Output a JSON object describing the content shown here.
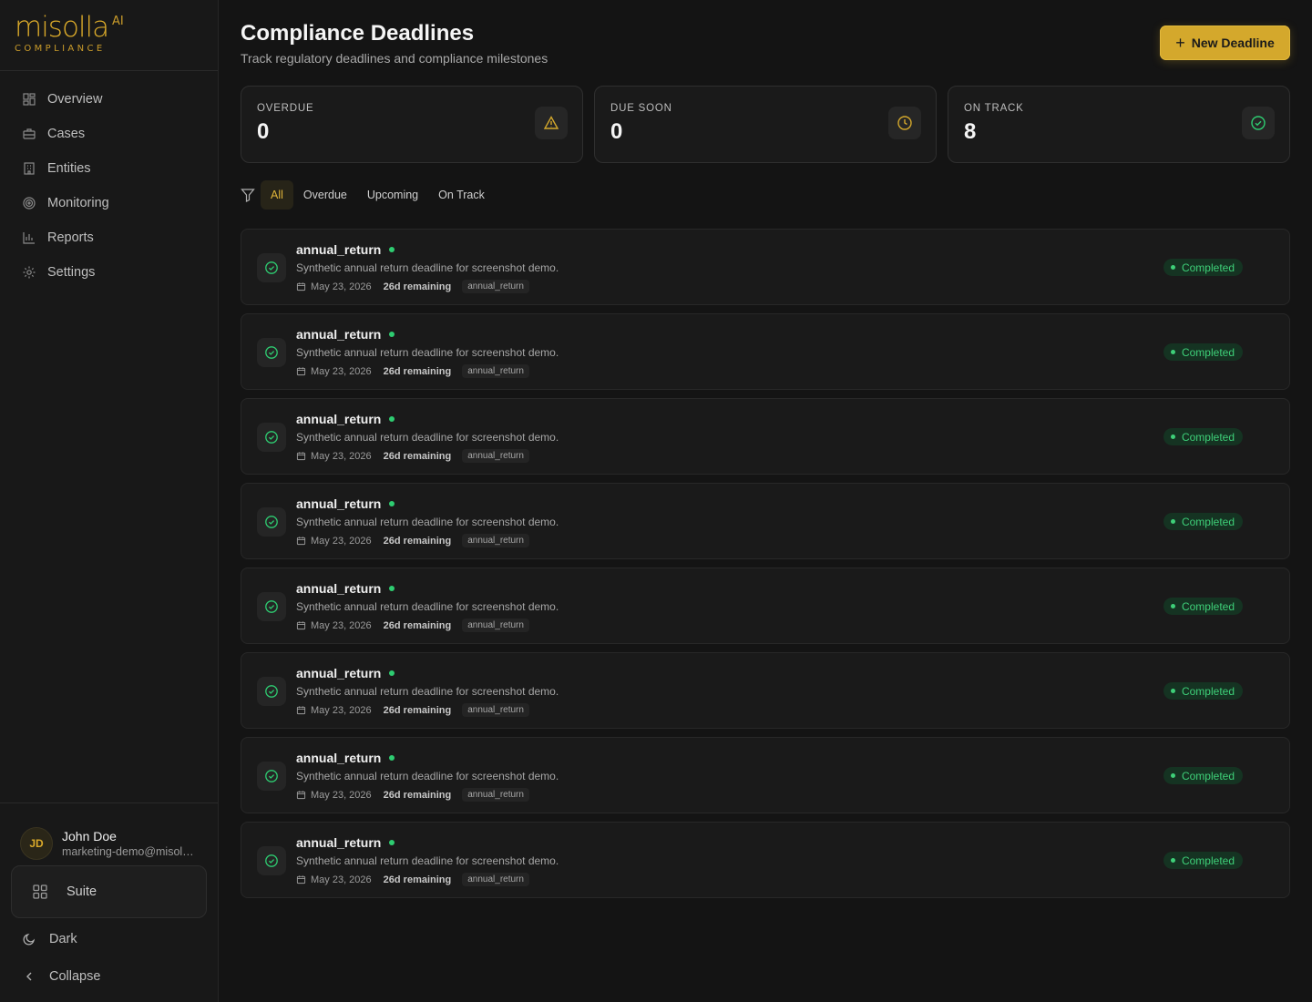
{
  "brand": {
    "name": "misolla",
    "ai": "AI",
    "sub": "COMPLIANCE",
    "accent": "#d4a82c"
  },
  "sidebar": {
    "items": [
      {
        "label": "Overview",
        "icon": "grid-icon"
      },
      {
        "label": "Cases",
        "icon": "briefcase-icon"
      },
      {
        "label": "Entities",
        "icon": "building-icon"
      },
      {
        "label": "Monitoring",
        "icon": "radar-icon"
      },
      {
        "label": "Reports",
        "icon": "bar-chart-icon"
      },
      {
        "label": "Settings",
        "icon": "gear-icon"
      }
    ],
    "user": {
      "initials": "JD",
      "name": "John Doe",
      "email": "marketing-demo@misolla.ai"
    },
    "suite_label": "Suite",
    "theme_label": "Dark",
    "collapse_label": "Collapse"
  },
  "header": {
    "title": "Compliance Deadlines",
    "subtitle": "Track regulatory deadlines and compliance milestones",
    "new_button": "New Deadline"
  },
  "stats": [
    {
      "label": "OVERDUE",
      "value": "0",
      "icon": "warning-icon",
      "color": "#d4a82c"
    },
    {
      "label": "DUE SOON",
      "value": "0",
      "icon": "clock-icon",
      "color": "#d4a82c"
    },
    {
      "label": "ON TRACK",
      "value": "8",
      "icon": "check-circle-icon",
      "color": "#2ecc71"
    }
  ],
  "filters": [
    "All",
    "Overdue",
    "Upcoming",
    "On Track"
  ],
  "deadlines": [
    {
      "title": "annual_return",
      "desc": "Synthetic annual return deadline for screenshot demo.",
      "date": "May 23, 2026",
      "remaining": "26d remaining",
      "tag": "annual_return",
      "status": "Completed"
    },
    {
      "title": "annual_return",
      "desc": "Synthetic annual return deadline for screenshot demo.",
      "date": "May 23, 2026",
      "remaining": "26d remaining",
      "tag": "annual_return",
      "status": "Completed"
    },
    {
      "title": "annual_return",
      "desc": "Synthetic annual return deadline for screenshot demo.",
      "date": "May 23, 2026",
      "remaining": "26d remaining",
      "tag": "annual_return",
      "status": "Completed"
    },
    {
      "title": "annual_return",
      "desc": "Synthetic annual return deadline for screenshot demo.",
      "date": "May 23, 2026",
      "remaining": "26d remaining",
      "tag": "annual_return",
      "status": "Completed"
    },
    {
      "title": "annual_return",
      "desc": "Synthetic annual return deadline for screenshot demo.",
      "date": "May 23, 2026",
      "remaining": "26d remaining",
      "tag": "annual_return",
      "status": "Completed"
    },
    {
      "title": "annual_return",
      "desc": "Synthetic annual return deadline for screenshot demo.",
      "date": "May 23, 2026",
      "remaining": "26d remaining",
      "tag": "annual_return",
      "status": "Completed"
    },
    {
      "title": "annual_return",
      "desc": "Synthetic annual return deadline for screenshot demo.",
      "date": "May 23, 2026",
      "remaining": "26d remaining",
      "tag": "annual_return",
      "status": "Completed"
    },
    {
      "title": "annual_return",
      "desc": "Synthetic annual return deadline for screenshot demo.",
      "date": "May 23, 2026",
      "remaining": "26d remaining",
      "tag": "annual_return",
      "status": "Completed"
    }
  ]
}
